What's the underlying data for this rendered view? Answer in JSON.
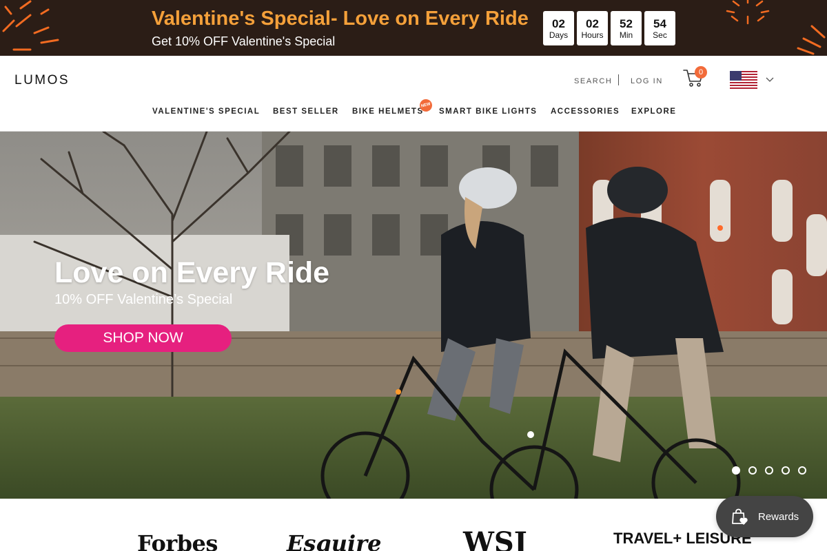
{
  "promo": {
    "title": "Valentine's Special- Love on Every Ride",
    "subtitle": "Get 10% OFF Valentine's Special",
    "countdown": [
      {
        "value": "02",
        "label": "Days"
      },
      {
        "value": "02",
        "label": "Hours"
      },
      {
        "value": "52",
        "label": "Min"
      },
      {
        "value": "54",
        "label": "Sec"
      }
    ],
    "accent_color": "#f4a03a",
    "background_color": "#2b1d16"
  },
  "header": {
    "logo": "LUMOS",
    "search_label": "SEARCH",
    "login_label": "LOG IN",
    "cart_count": "0",
    "country_flag": "us-flag-icon"
  },
  "nav": {
    "items": [
      {
        "label": "VALENTINE'S SPECIAL"
      },
      {
        "label": "BEST SELLER"
      },
      {
        "label": "BIKE HELMETS",
        "badge": "NEW"
      },
      {
        "label": "SMART BIKE LIGHTS"
      },
      {
        "label": "ACCESSORIES"
      },
      {
        "label": "EXPLORE"
      }
    ]
  },
  "hero": {
    "title": "Love on Every Ride",
    "subtitle": "10% OFF Valentine’s Special",
    "cta_label": "SHOP NOW",
    "cta_color": "#e6207f",
    "slide_count": 5,
    "active_slide": 1
  },
  "press": {
    "logos": [
      "Forbes",
      "Esquire",
      "WSJ",
      "TRAVEL+ LEISURE"
    ]
  },
  "rewards": {
    "label": "Rewards"
  }
}
